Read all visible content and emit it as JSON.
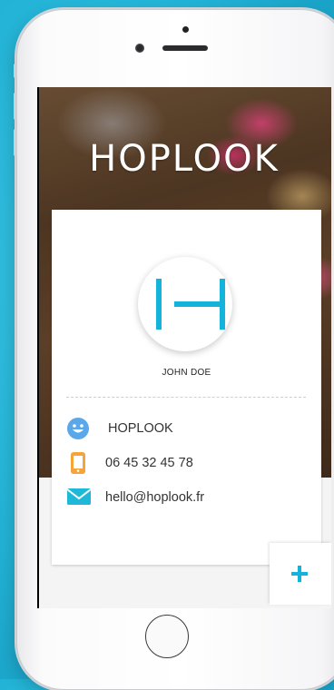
{
  "app": {
    "brand_title": "HOPLOOK",
    "accent_color": "#14b3dc"
  },
  "profile": {
    "name": "JOHN DOE",
    "avatar_letter": "H",
    "contacts": [
      {
        "icon": "smiley-icon",
        "text": "HOPLOOK",
        "color": "#5aa8ea"
      },
      {
        "icon": "phone-icon",
        "text": "06 45 32 45 78",
        "color": "#f4a43a"
      },
      {
        "icon": "mail-icon",
        "text": "hello@hoplook.fr",
        "color": "#1fb8d8"
      }
    ]
  },
  "actions": {
    "add_icon": "plus-icon"
  }
}
